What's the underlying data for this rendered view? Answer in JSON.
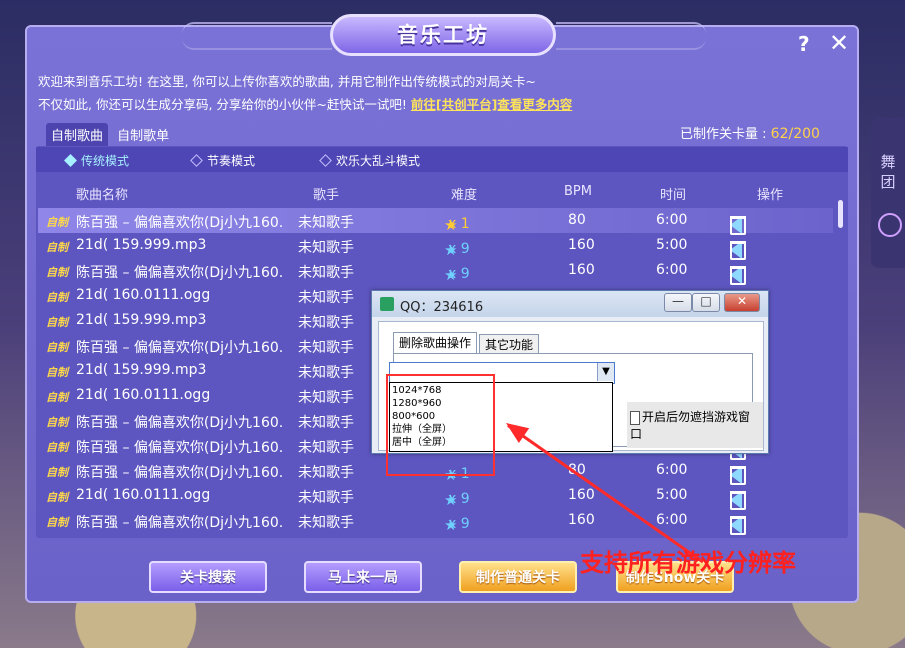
{
  "window": {
    "title": "音乐工坊",
    "help": "?",
    "close": "✕"
  },
  "side_tab": {
    "label": "舞团"
  },
  "intro": {
    "line1": "欢迎来到音乐工坊! 在这里, 你可以上传你喜欢的歌曲, 并用它制作出传统模式的对局关卡~",
    "line2": "不仅如此, 你还可以生成分享码, 分享给你的小伙伴~赶快试一试吧!",
    "link": "前往[共创平台]查看更多内容"
  },
  "subtabs": [
    {
      "label": "自制歌曲",
      "active": true
    },
    {
      "label": "自制歌单",
      "active": false
    }
  ],
  "level_count": {
    "label": "已制作关卡量 :",
    "value": "62/200"
  },
  "modes": [
    {
      "label": "传统模式",
      "active": true
    },
    {
      "label": "节奏模式",
      "active": false
    },
    {
      "label": "欢乐大乱斗模式",
      "active": false
    }
  ],
  "columns": {
    "name": "歌曲名称",
    "singer": "歌手",
    "difficulty": "难度",
    "bpm": "BPM",
    "time": "时间",
    "ops": "操作"
  },
  "rows": [
    {
      "tag": "自制",
      "name": "陈百强 – 偏偏喜欢你(Dj小九160.",
      "singer": "未知歌手",
      "diff": "x 1",
      "bpm": "80",
      "time": "6:00",
      "selected": true,
      "gold": true
    },
    {
      "tag": "自制",
      "name": "21d( 159.999.mp3",
      "singer": "未知歌手",
      "diff": "x 9",
      "bpm": "160",
      "time": "5:00"
    },
    {
      "tag": "自制",
      "name": "陈百强 – 偏偏喜欢你(Dj小九160.",
      "singer": "未知歌手",
      "diff": "x 9",
      "bpm": "160",
      "time": "6:00"
    },
    {
      "tag": "自制",
      "name": "21d( 160.0111.ogg",
      "singer": "未知歌手",
      "diff": "",
      "bpm": "",
      "time": ""
    },
    {
      "tag": "自制",
      "name": "21d( 159.999.mp3",
      "singer": "未知歌手",
      "diff": "",
      "bpm": "",
      "time": ""
    },
    {
      "tag": "自制",
      "name": "陈百强 – 偏偏喜欢你(Dj小九160.",
      "singer": "未知歌手",
      "diff": "",
      "bpm": "",
      "time": ""
    },
    {
      "tag": "自制",
      "name": "21d( 159.999.mp3",
      "singer": "未知歌手",
      "diff": "",
      "bpm": "",
      "time": ""
    },
    {
      "tag": "自制",
      "name": "21d( 160.0111.ogg",
      "singer": "未知歌手",
      "diff": "",
      "bpm": "",
      "time": ""
    },
    {
      "tag": "自制",
      "name": "陈百强 – 偏偏喜欢你(Dj小九160.",
      "singer": "未知歌手",
      "diff": "",
      "bpm": "",
      "time": ""
    },
    {
      "tag": "自制",
      "name": "陈百强 – 偏偏喜欢你(Dj小九160.",
      "singer": "未知歌手",
      "diff": "",
      "bpm": "",
      "time": ""
    },
    {
      "tag": "自制",
      "name": "陈百强 – 偏偏喜欢你(Dj小九160.",
      "singer": "未知歌手",
      "diff": "x 1",
      "bpm": "80",
      "time": "6:00"
    },
    {
      "tag": "自制",
      "name": "21d( 160.0111.ogg",
      "singer": "未知歌手",
      "diff": "x 9",
      "bpm": "160",
      "time": "5:00"
    },
    {
      "tag": "自制",
      "name": "陈百强 – 偏偏喜欢你(Dj小九160.",
      "singer": "未知歌手",
      "diff": "x 9",
      "bpm": "160",
      "time": "6:00"
    }
  ],
  "buttons": {
    "search": "关卡搜索",
    "play": "马上来一局",
    "make_normal": "制作普通关卡",
    "make_show": "制作Show关卡"
  },
  "qq": {
    "title": "QQ：234616",
    "min": "—",
    "max": "□",
    "close": "✕",
    "tabs": [
      "删除歌曲操作",
      "其它功能"
    ],
    "dropdown_arrow": "▼",
    "options": [
      "1024*768",
      "1280*960",
      "800*600",
      "拉伸（全屏）",
      "居中（全屏）"
    ],
    "checkbox_label": "开启后勿遮挡游戏窗口"
  },
  "annotation": {
    "text": "支持所有游戏分辨率",
    "color": "#ff2020"
  },
  "colors": {
    "panel": "#6e66cc",
    "accent": "#ffd24a",
    "link": "#ffe45a"
  }
}
